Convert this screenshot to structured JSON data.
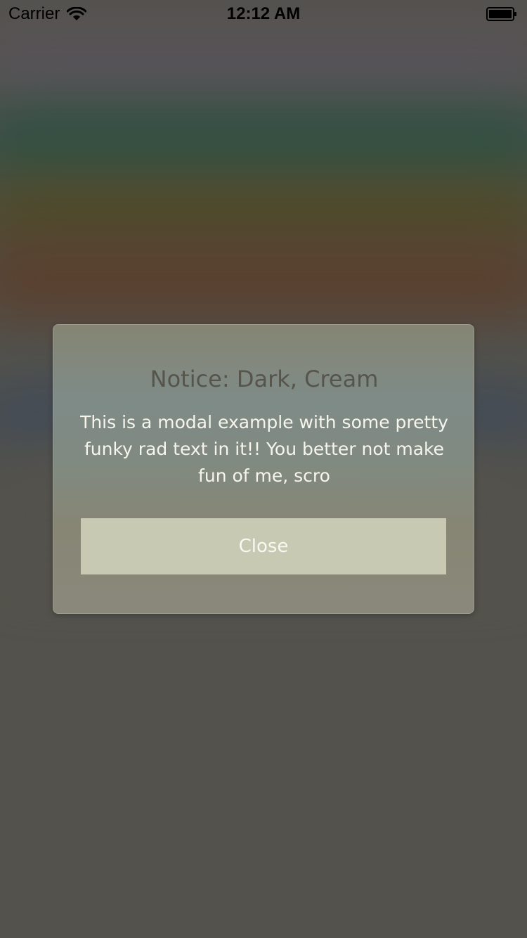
{
  "status_bar": {
    "carrier": "Carrier",
    "time": "12:12 AM",
    "icons": [
      "wifi-icon",
      "battery-icon"
    ]
  },
  "modal": {
    "title": "Notice: Dark, Cream",
    "body": "This is a modal example with some pretty funky rad text in it!! You better not make fun of me, scro",
    "close_label": "Close"
  },
  "colors": {
    "background": "#55534e",
    "modal_title": "#55554c",
    "modal_body_text": "#f6f5ec",
    "close_button_bg": "#c8c9b3"
  }
}
